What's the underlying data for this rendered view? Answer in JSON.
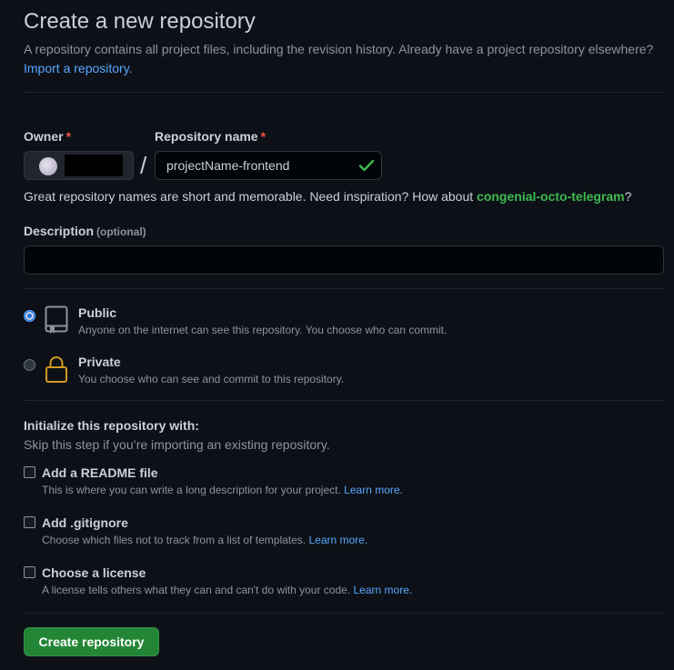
{
  "header": {
    "title": "Create a new repository",
    "subtitle": "A repository contains all project files, including the revision history. Already have a project repository elsewhere?",
    "import_link": "Import a repository."
  },
  "owner": {
    "label": "Owner",
    "required_mark": "*"
  },
  "repo_name": {
    "label": "Repository name",
    "required_mark": "*",
    "value": "projectName-frontend",
    "separator": "/"
  },
  "name_hint": {
    "text": "Great repository names are short and memorable. Need inspiration? How about",
    "suggestion": "congenial-octo-telegram",
    "suffix": "?"
  },
  "description": {
    "label": "Description",
    "optional": "(optional)",
    "value": ""
  },
  "visibility": {
    "selected": "public",
    "options": [
      {
        "title": "Public",
        "desc": "Anyone on the internet can see this repository. You choose who can commit.",
        "icon": "repo-icon"
      },
      {
        "title": "Private",
        "desc": "You choose who can see and commit to this repository.",
        "icon": "lock-icon"
      }
    ]
  },
  "init": {
    "title": "Initialize this repository with:",
    "subtitle": "Skip this step if you’re importing an existing repository.",
    "options": [
      {
        "title": "Add a README file",
        "desc": "This is where you can write a long description for your project.",
        "link": "Learn more.",
        "checked": false
      },
      {
        "title": "Add .gitignore",
        "desc": "Choose which files not to track from a list of templates.",
        "link": "Learn more.",
        "checked": false
      },
      {
        "title": "Choose a license",
        "desc": "A license tells others what they can and can't do with your code.",
        "link": "Learn more.",
        "checked": false
      }
    ]
  },
  "submit": {
    "label": "Create repository"
  },
  "colors": {
    "background": "#0d1117",
    "primary_button": "#238636",
    "link": "#58a6ff",
    "success": "#3fb950",
    "required": "#f85149",
    "lock": "#d29922"
  }
}
